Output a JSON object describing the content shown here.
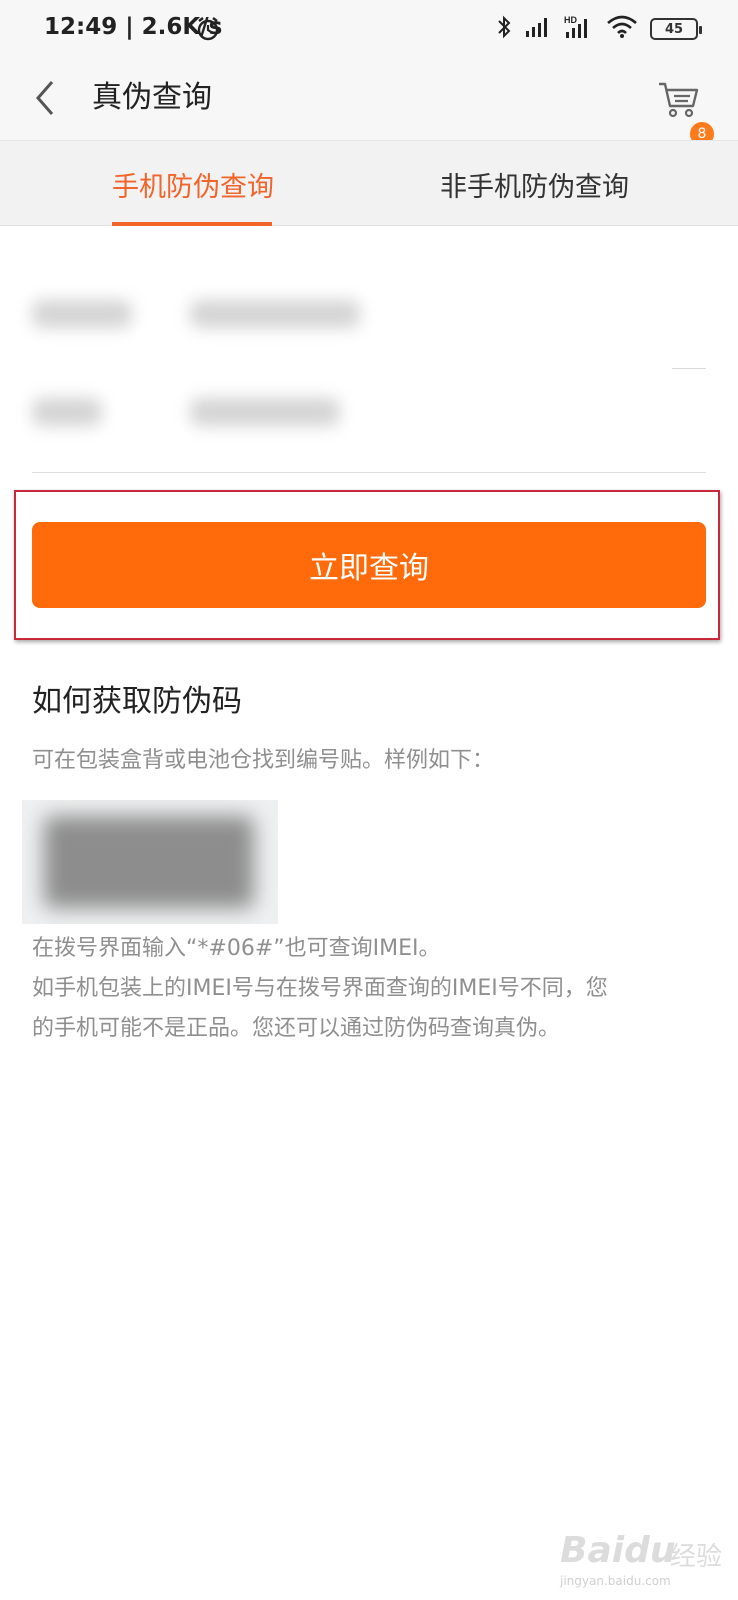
{
  "status_bar": {
    "time": "12:49 | 2.6K/s",
    "battery": "45",
    "icons": [
      "alarm-icon",
      "bluetooth-icon",
      "signal-icon",
      "hd-signal-icon",
      "wifi-icon",
      "battery-icon"
    ]
  },
  "header": {
    "title": "真伪查询",
    "cart_count": "8"
  },
  "tabs": [
    {
      "label": "手机防伪查询",
      "active": true
    },
    {
      "label": "非手机防伪查询",
      "active": false
    }
  ],
  "form": {
    "button_label": "立即查询"
  },
  "help": {
    "title": "如何获取防伪码",
    "text": "可在包装盒背或电池仓找到编号贴。样例如下：",
    "note_line1": "在拨号界面输入“*#06#”也可查询IMEI。",
    "note_line2": "如手机包装上的IMEI号与在拨号界面查询的IMEI号不同，您",
    "note_line3": "的手机可能不是正品。您还可以通过防伪码查询真伪。"
  },
  "watermark": {
    "logo": "Baidu",
    "cn": "经验",
    "url": "jingyan.baidu.com"
  },
  "colors": {
    "accent": "#f2642a",
    "button": "#ff6a0a",
    "highlight": "#c8283a"
  }
}
